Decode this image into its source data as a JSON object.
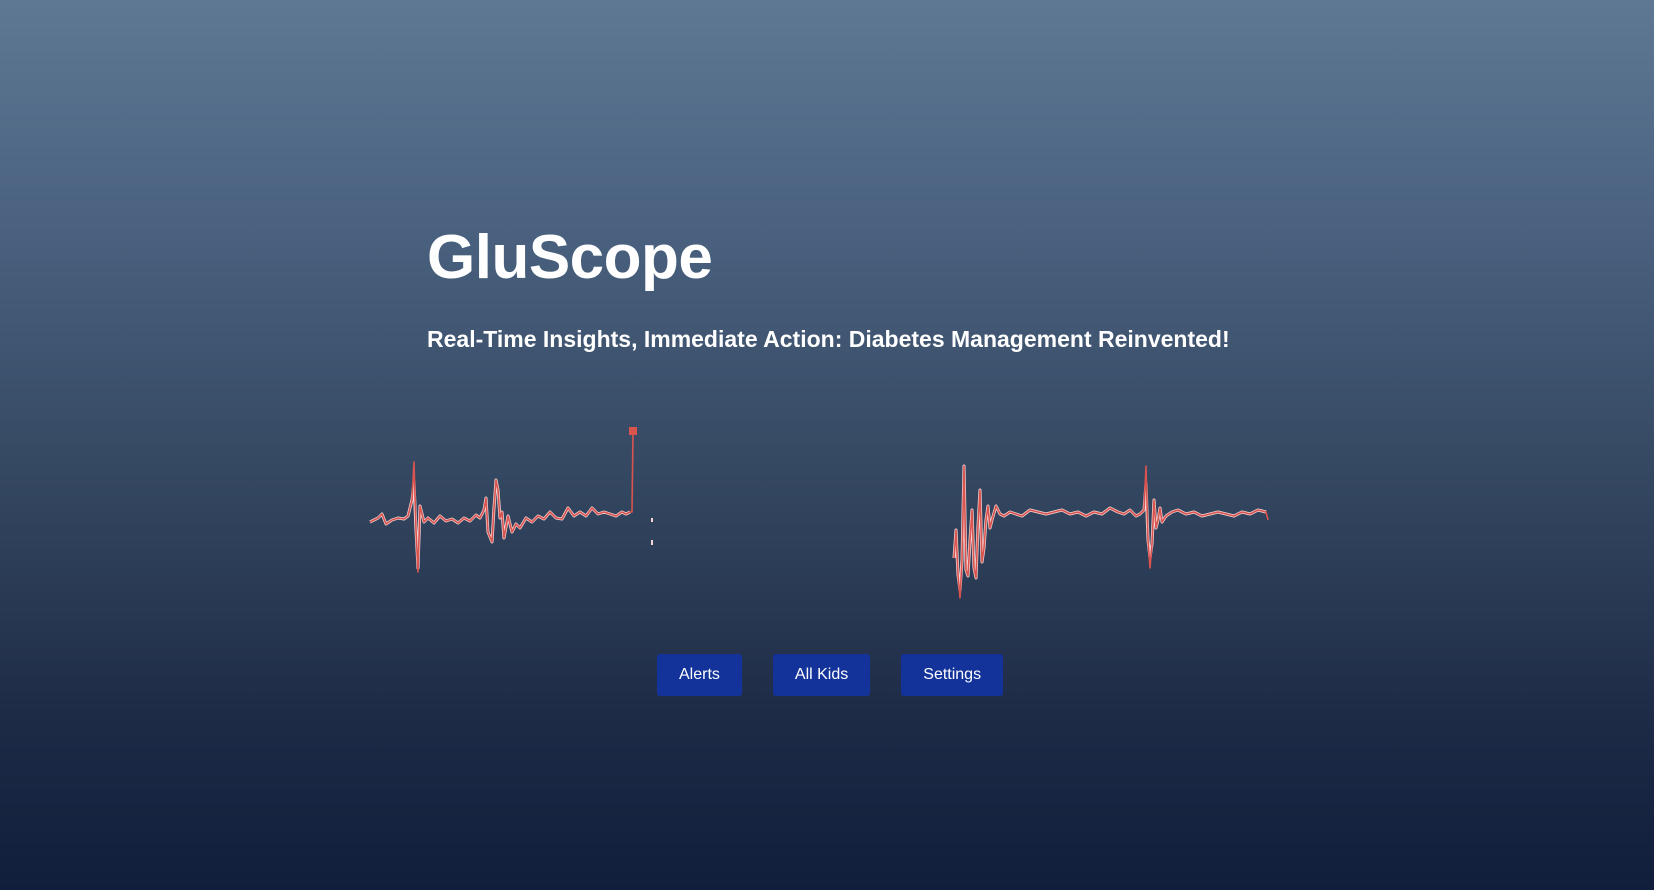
{
  "hero": {
    "title": "GluScope",
    "subtitle": "Real-Time Insights, Immediate Action: Diabetes Management Reinvented!"
  },
  "graphics": {
    "left": "glucose-waveform-graphic",
    "right": "glucose-waveform-graphic",
    "colors": {
      "trace_primary": "#d9534f",
      "trace_secondary": "#f3d6d6"
    }
  },
  "nav": {
    "buttons": [
      "Alerts",
      "All Kids",
      "Settings"
    ]
  },
  "colors": {
    "background_top": "#5e7893",
    "background_bottom": "#111e3b",
    "button": "#13339a",
    "text": "#ffffff"
  }
}
